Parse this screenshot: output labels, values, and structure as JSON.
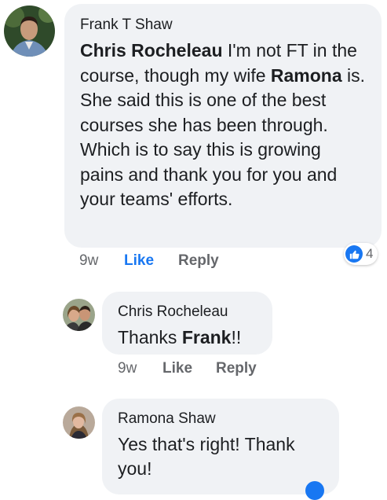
{
  "comments": [
    {
      "author": "Frank T Shaw",
      "mention": "Chris Rocheleau",
      "text_1": " I'm not FT in the course, though my wife ",
      "mention_2": "Ramona",
      "text_2": " is. She said this is one of the best courses she has been through. Which is to say this is growing pains and thank you for you and your teams' efforts.",
      "time": "9w",
      "like_label": "Like",
      "reply_label": "Reply",
      "reaction_count": "4"
    },
    {
      "author": "Chris Rocheleau",
      "text_1": "Thanks ",
      "mention": "Frank",
      "text_2": "!!",
      "time": "9w",
      "like_label": "Like",
      "reply_label": "Reply"
    },
    {
      "author": "Ramona Shaw",
      "text": "Yes that's right! Thank you!"
    }
  ],
  "colors": {
    "bubble": "#f0f2f5",
    "link_blue": "#1877f2",
    "meta_gray": "#65676b"
  }
}
